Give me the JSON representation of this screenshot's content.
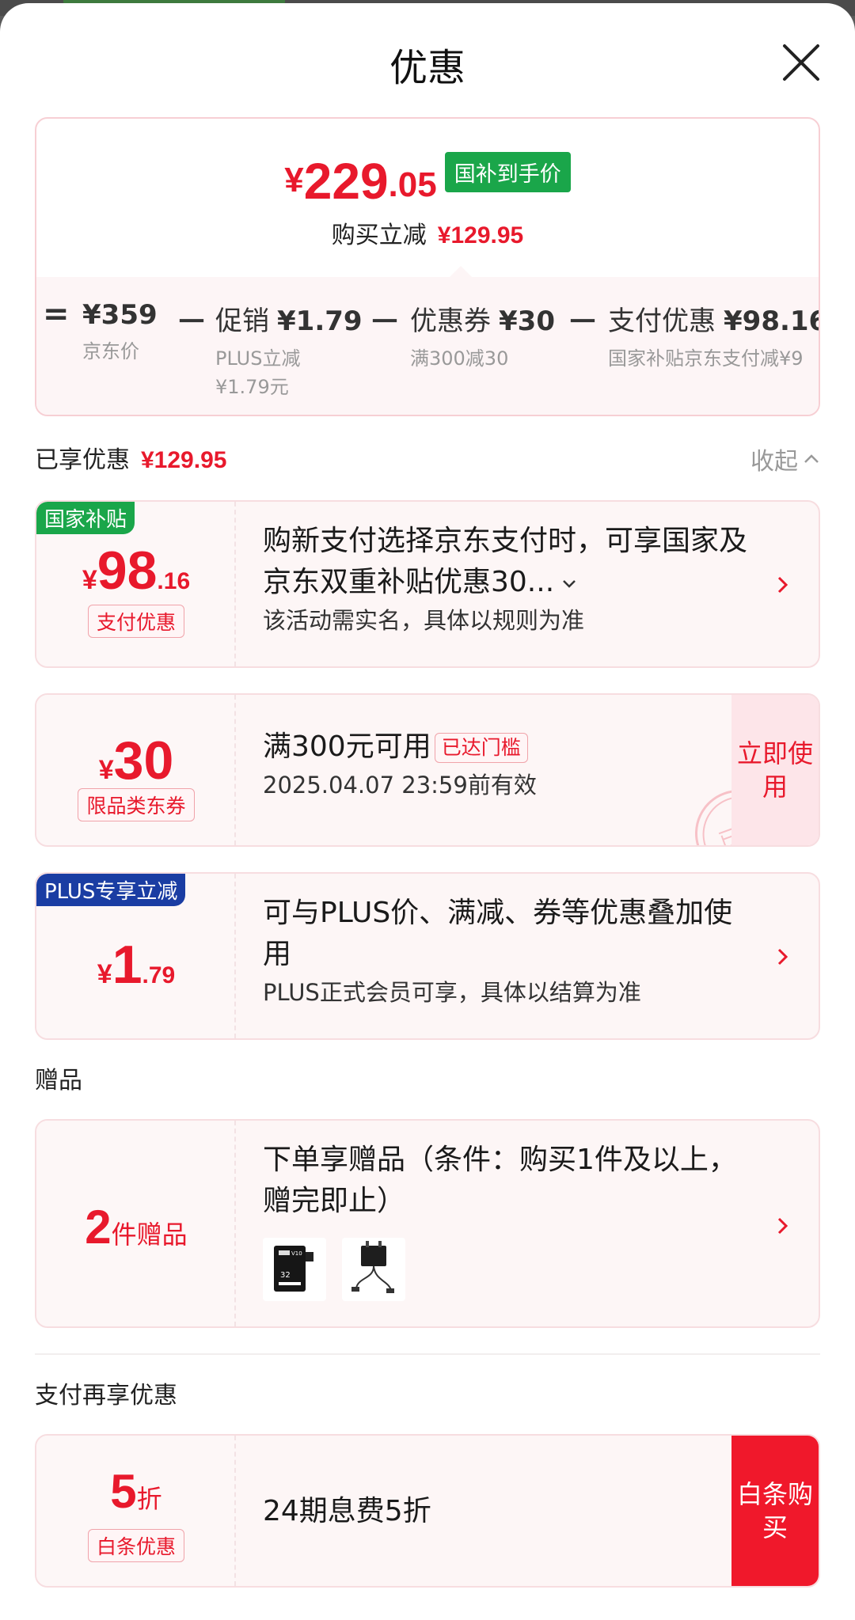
{
  "header": {
    "title": "优惠"
  },
  "summary": {
    "yen": "¥",
    "final_int": "229",
    "final_dec": ".05",
    "final_tag": "国补到手价",
    "saving_label": "购买立减",
    "saving_value": "¥129.95",
    "breakdown": [
      {
        "op": "=",
        "label": "",
        "value": "¥359",
        "sub1": "京东价",
        "sub2": ""
      },
      {
        "op": "－",
        "label": "促销",
        "value": "¥1.79",
        "sub1": "PLUS立减",
        "sub2": "¥1.79元"
      },
      {
        "op": "－",
        "label": "优惠券",
        "value": "¥30",
        "sub1": "满300减30",
        "sub2": ""
      },
      {
        "op": "－",
        "label": "支付优惠",
        "value": "¥98.16",
        "sub1": "国家补贴京东支付减¥9",
        "sub2": ""
      }
    ]
  },
  "enjoyed": {
    "label": "已享优惠",
    "value": "¥129.95",
    "collapse": "收起"
  },
  "cards": {
    "subsidy": {
      "corner": "国家补贴",
      "yen": "¥",
      "int": "98",
      "dec": ".16",
      "pill": "支付优惠",
      "title": "购新支付选择京东支付时，可享国家及京东双重补贴优惠30...",
      "desc": "该活动需实名，具体以规则为准"
    },
    "coupon": {
      "yen": "¥",
      "int": "30",
      "pill": "限品类东券",
      "title": "满300元可用",
      "tag": "已达门槛",
      "desc": "2025.04.07 23:59前有效",
      "button": "立即使用",
      "stamp": "已领"
    },
    "plus": {
      "corner": "PLUS专享立减",
      "yen": "¥",
      "int": "1",
      "dec": ".79",
      "title": "可与PLUS价、满减、券等优惠叠加使用",
      "desc": "PLUS正式会员可享，具体以结算为准"
    }
  },
  "gift_section": {
    "heading": "赠品",
    "count": "2",
    "unit": "件赠品",
    "title": "下单享赠品（条件：购买1件及以上，赠完即止）",
    "items": [
      "microSD card 32GB",
      "power adapter"
    ]
  },
  "pay_section": {
    "heading": "支付再享优惠",
    "int": "5",
    "unit": "折",
    "pill": "白条优惠",
    "title": "24期息费5折",
    "button": "白条购买"
  },
  "colors": {
    "accent": "#e8192c",
    "green": "#1aa64a",
    "plus_blue": "#1a3da3"
  }
}
